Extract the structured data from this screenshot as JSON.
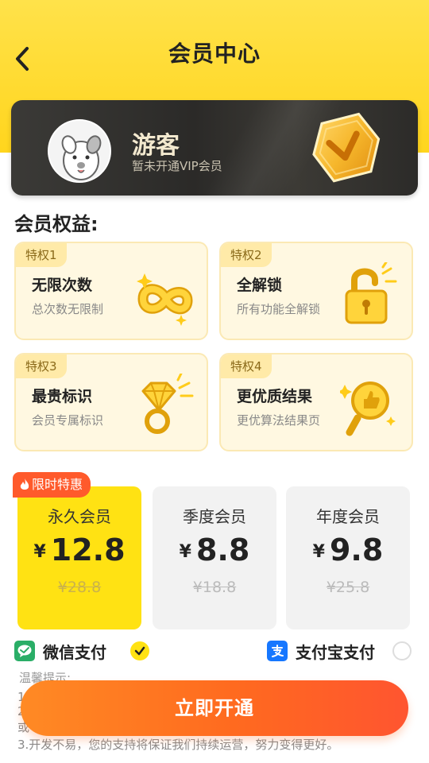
{
  "header": {
    "title": "会员中心"
  },
  "user": {
    "name": "游客",
    "status": "暂未开通VIP会员"
  },
  "benefits": {
    "title": "会员权益:",
    "items": [
      {
        "tag": "特权1",
        "title": "无限次数",
        "desc": "总次数无限制",
        "icon": "infinity-icon"
      },
      {
        "tag": "特权2",
        "title": "全解锁",
        "desc": "所有功能全解锁",
        "icon": "unlock-icon"
      },
      {
        "tag": "特权3",
        "title": "最贵标识",
        "desc": "会员专属标识",
        "icon": "diamond-ring-icon"
      },
      {
        "tag": "特权4",
        "title": "更优质结果",
        "desc": "更优算法结果页",
        "icon": "magnifier-thumb-icon"
      }
    ]
  },
  "plans": {
    "promo_label": "限时特惠",
    "currency": "¥",
    "items": [
      {
        "name": "永久会员",
        "price": "12.8",
        "original": "¥28.8",
        "selected": true
      },
      {
        "name": "季度会员",
        "price": "8.8",
        "original": "¥18.8",
        "selected": false
      },
      {
        "name": "年度会员",
        "price": "9.8",
        "original": "¥25.8",
        "selected": false
      }
    ]
  },
  "payment": {
    "wechat_label": "微信支付",
    "alipay_label": "支付宝支付",
    "selected": "wechat"
  },
  "tips": {
    "title": "温馨提示:",
    "line1": "1.",
    "line2": "2.",
    "line3": "或",
    "line4": "3.开发不易，您的支持将保证我们持续运营，努力变得更好。"
  },
  "cta": {
    "label": "立即开通"
  },
  "colors": {
    "brand_yellow": "#ffe213",
    "cta_orange": "#ff6a1f",
    "promo_red": "#ff5a2b",
    "wechat_green": "#2aae67",
    "alipay_blue": "#1677ff"
  }
}
